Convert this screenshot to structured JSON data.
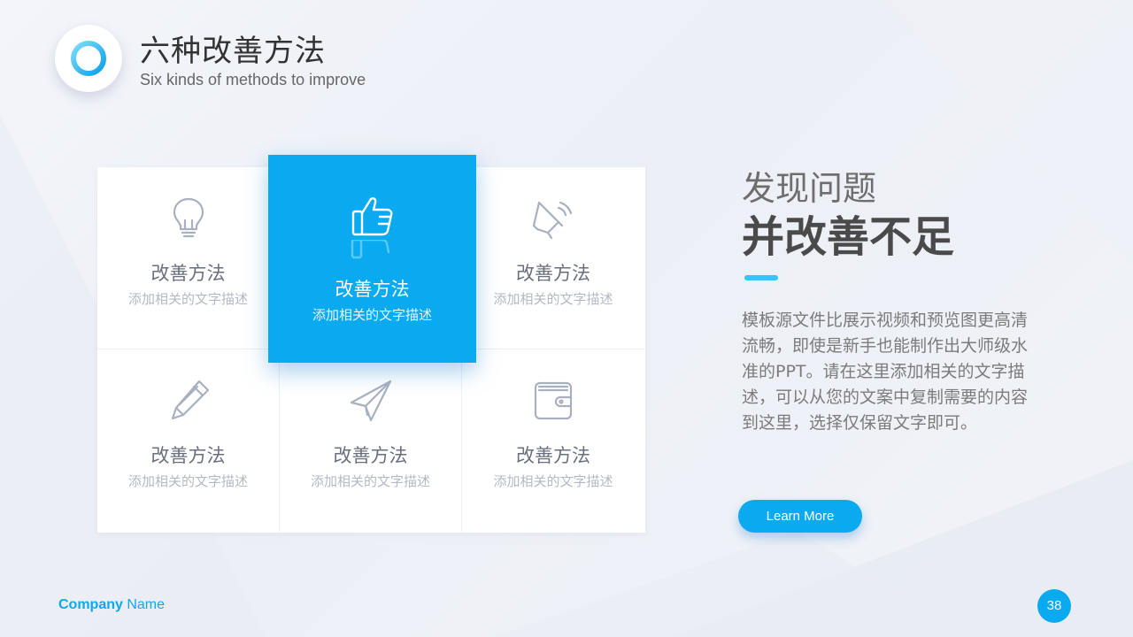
{
  "header": {
    "title_cn": "六种改善方法",
    "title_en": "Six kinds of methods to improve"
  },
  "grid": {
    "cells": [
      {
        "icon": "lightbulb-icon",
        "label": "改善方法",
        "desc": "添加相关的文字描述"
      },
      {
        "icon": "thumbs-up-icon",
        "label": "改善方法",
        "desc": "添加相关的文字描述",
        "active": true
      },
      {
        "icon": "megaphone-icon",
        "label": "改善方法",
        "desc": "添加相关的文字描述"
      },
      {
        "icon": "pencil-icon",
        "label": "改善方法",
        "desc": "添加相关的文字描述"
      },
      {
        "icon": "paper-plane-icon",
        "label": "改善方法",
        "desc": "添加相关的文字描述"
      },
      {
        "icon": "wallet-icon",
        "label": "改善方法",
        "desc": "添加相关的文字描述"
      }
    ]
  },
  "right": {
    "heading_light": "发现问题",
    "heading_bold": "并改善不足",
    "body": "模板源文件比展示视频和预览图更高清流畅，即使是新手也能制作出大师级水准的PPT。请在这里添加相关的文字描述，可以从您的文案中复制需要的内容到这里，选择仅保留文字即可。",
    "button_label": "Learn More"
  },
  "footer": {
    "company_bold": "Company",
    "company_rest": " Name",
    "page_number": "38"
  },
  "colors": {
    "accent": "#0aaaf0",
    "icon_stroke": "#a9b0c0"
  }
}
